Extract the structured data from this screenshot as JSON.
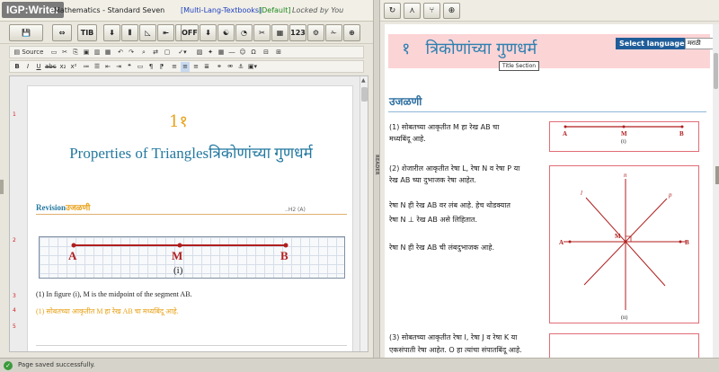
{
  "app": {
    "logo": "IGP:Writer",
    "title": "Mathematics - Standard Seven",
    "book_link": "[Multi-Lang-Textbooks]",
    "default_tag": "[Default]",
    "lock_status": "Locked by You"
  },
  "toolbar": {
    "buttons": [
      {
        "name": "save-button",
        "label": "💾"
      },
      {
        "name": "swap-button",
        "label": "⇔"
      },
      {
        "name": "tib-button",
        "label": "TIB"
      },
      {
        "name": "fill-button",
        "label": "⬇"
      },
      {
        "name": "column-button",
        "label": "⦀"
      },
      {
        "name": "triangle-button",
        "label": "◺"
      },
      {
        "name": "merge-button",
        "label": "⇤"
      },
      {
        "name": "angle-button",
        "label": "⋟"
      },
      {
        "name": "off-button",
        "label": "OFF"
      },
      {
        "name": "down-button",
        "label": "⬇"
      },
      {
        "name": "yinyang-button",
        "label": "☯"
      },
      {
        "name": "nodes-button",
        "label": "◔"
      },
      {
        "name": "cut-button",
        "label": "✂"
      },
      {
        "name": "table-button",
        "label": "▦"
      },
      {
        "name": "numeric-button",
        "label": "123"
      },
      {
        "name": "settings-button",
        "label": "⚙"
      },
      {
        "name": "scissors-button",
        "label": "✁"
      },
      {
        "name": "link-button",
        "label": "⊕"
      }
    ]
  },
  "editor": {
    "source_label": "Source",
    "chapter_number": "1१",
    "title_en": "Properties of Triangles",
    "title_mr": "त्रिकोणांच्या गुणधर्म",
    "revision_en": "Revision",
    "revision_mr": "उजळणी",
    "h2_tag": "..H2 (A)",
    "fig_point_a": "A",
    "fig_point_m": "M",
    "fig_point_b": "B",
    "fig_label": "(i)",
    "para_en": "(1) In figure (i), M is the midpoint of the segment AB.",
    "para_mr": "(1) सोबतच्या आकृतीत M हा रेख AB चा मध्यबिंदू आहे.",
    "line_numbers": [
      "1",
      "2",
      "3",
      "4",
      "5"
    ],
    "reader_label": "READER"
  },
  "reader": {
    "select_language_label": "Select language",
    "language_value": "मराठी",
    "title_number": "१",
    "title": "त्रिकोणांच्या गुणधर्म",
    "tooltip": "Title Section",
    "subheading": "उजळणी",
    "p1_line1": "(1) सोबतच्या आकृतीत M हा रेख AB चा",
    "p1_line2": "मध्यबिंदू आहे.",
    "p2_line1": "(2) शेजारील आकृतीत रेषा L, रेषा N व रेषा P या",
    "p2_line2": "रेख AB च्या दुभाजक रेषा आहेत.",
    "p3_line1": "रेषा N ही रेख AB वर लंब आहे. हेच थोडक्यात",
    "p3_line2": "रेषा N ⊥ रेख AB असे लिहितात.",
    "p4": "रेषा N ही रेख AB ची लंबदुभाजक आहे.",
    "p5_line1": "(3) सोबतच्या आकृतीत रेषा I, रेषा J व रेषा K या",
    "p5_line2": "एकसंपाती रेषा आहेत. O हा त्यांचा संपातबिंदू आहे.",
    "fig1": {
      "a": "A",
      "m": "M",
      "b": "B",
      "label": "(i)"
    },
    "fig2": {
      "a": "A",
      "m": "M",
      "b": "B",
      "n": "n",
      "l": "l",
      "p": "p",
      "label": "(ii)"
    }
  },
  "status": {
    "message": "Page saved successfully."
  },
  "colors": {
    "heading_blue": "#2479a0",
    "marathi_orange": "#e8a21b",
    "figure_red": "#b01e1e",
    "title_band_pink": "#fbd4d6"
  }
}
